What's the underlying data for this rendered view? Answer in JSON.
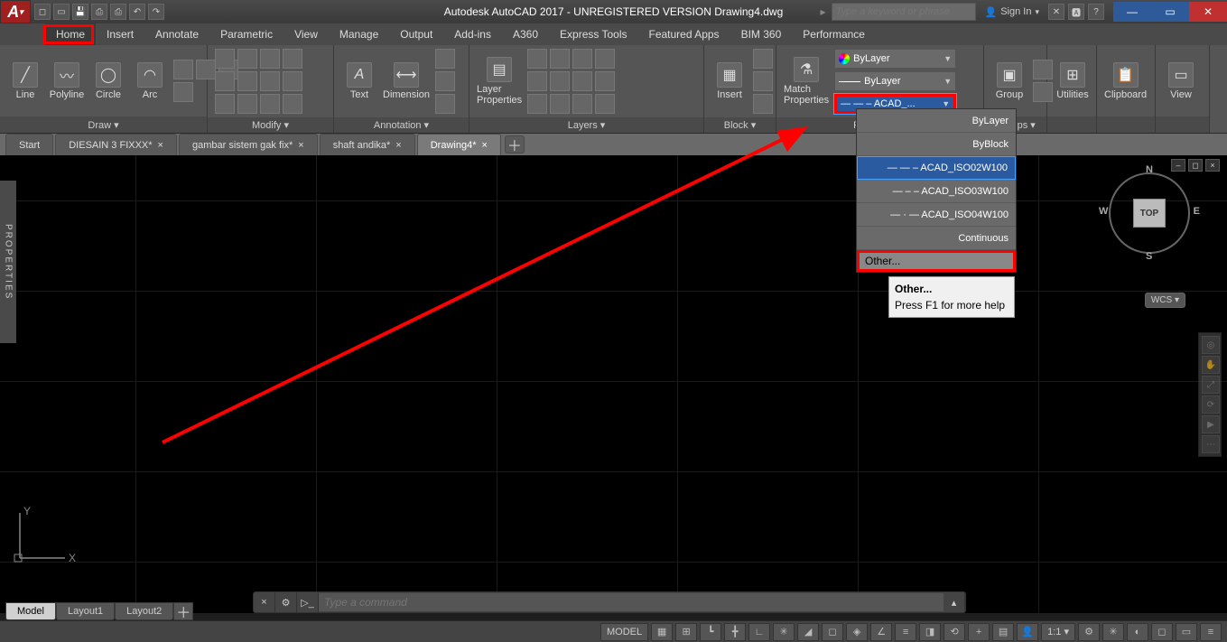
{
  "title": "Autodesk AutoCAD 2017 - UNREGISTERED VERSION    Drawing4.dwg",
  "search_placeholder": "Type a keyword or phrase",
  "signin": "Sign In",
  "ribbon_tabs": [
    "Home",
    "Insert",
    "Annotate",
    "Parametric",
    "View",
    "Manage",
    "Output",
    "Add-ins",
    "A360",
    "Express Tools",
    "Featured Apps",
    "BIM 360",
    "Performance"
  ],
  "panels": {
    "draw": {
      "title": "Draw ▾",
      "btns": [
        "Line",
        "Polyline",
        "Circle",
        "Arc"
      ]
    },
    "modify": {
      "title": "Modify ▾"
    },
    "annotation": {
      "title": "Annotation ▾",
      "btns": [
        "Text",
        "Dimension"
      ]
    },
    "layers": {
      "title": "Layers ▾",
      "btn": "Layer\nProperties"
    },
    "block": {
      "title": "Block ▾",
      "btn": "Insert"
    },
    "properties": {
      "title": "Properties ▾",
      "btn": "Match\nProperties",
      "color": "ByLayer",
      "lineweight": "ByLayer",
      "linetype": "— — – ACAD_..."
    },
    "groups": {
      "title": "Groups ▾",
      "btn": "Group"
    },
    "utilities": {
      "title": "Utilities ▾"
    },
    "clipboard": {
      "title": "Clipboard ▾"
    },
    "view": {
      "title": "View ▾"
    }
  },
  "linetype_list": [
    "ByLayer",
    "ByBlock",
    "— — – ACAD_ISO02W100",
    "— – – ACAD_ISO03W100",
    "— · — ACAD_ISO04W100",
    "Continuous"
  ],
  "linetype_other": "Other...",
  "tooltip": {
    "hd": "Other...",
    "body": "Press F1 for more help"
  },
  "doc_tabs": [
    "Start",
    "DIESAIN 3 FIXXX*",
    "gambar sistem gak fix*",
    "shaft andika*",
    "Drawing4*"
  ],
  "active_doc": 4,
  "layout_tabs": [
    "Model",
    "Layout1",
    "Layout2"
  ],
  "viewcube": {
    "face": "TOP",
    "n": "N",
    "s": "S",
    "e": "E",
    "w": "W",
    "wcs": "WCS ▾"
  },
  "cmd_placeholder": "Type a command",
  "status": {
    "model": "MODEL",
    "scale": "1:1 ▾"
  },
  "props_sidebar": "PROPERTIES"
}
